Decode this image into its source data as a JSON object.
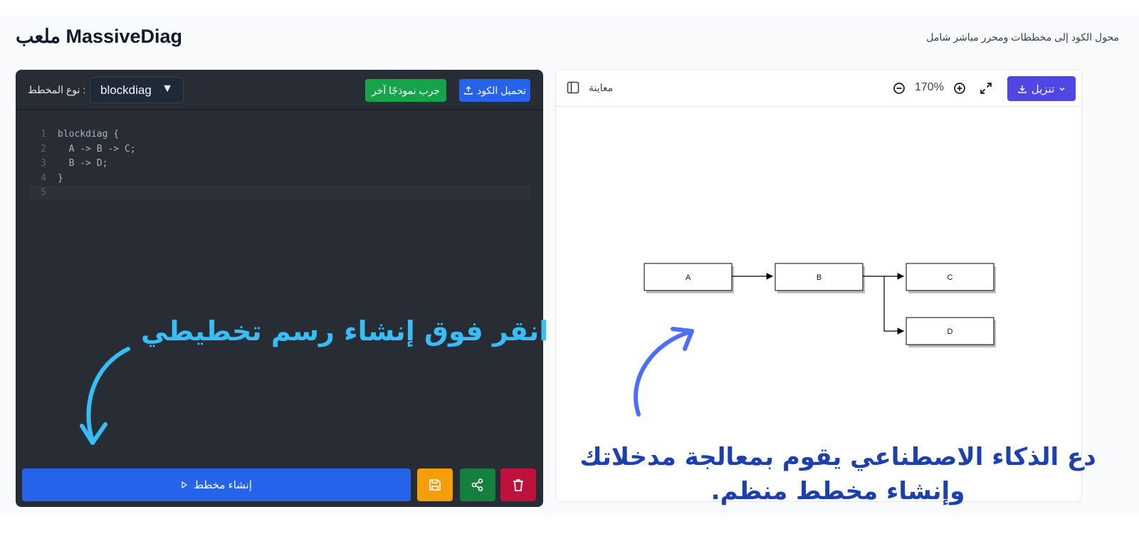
{
  "header": {
    "brand": "MassiveDiag ملعب",
    "tagline": "محول الكود إلى مخططات ومحرر مباشر شامل"
  },
  "editor": {
    "type_label": ": نوع المخطط",
    "type_value": "blockdiag",
    "try_example_label": "جرب نموذجًا آخر",
    "upload_label": "تحميل الكود",
    "code_lines": [
      {
        "n": "1",
        "text": "blockdiag {"
      },
      {
        "n": "2",
        "text": "  A -> B -> C;"
      },
      {
        "n": "3",
        "text": "  B -> D;"
      },
      {
        "n": "4",
        "text": "}"
      },
      {
        "n": "5",
        "text": ""
      }
    ],
    "generate_label": "إنشاء مخطط",
    "colors": {
      "bg": "#282c34",
      "generate": "#2563eb",
      "save": "#f59e0b",
      "share": "#15803d",
      "delete": "#be123c"
    }
  },
  "preview": {
    "title": "معاينة",
    "zoom": "170%",
    "download_label": "تنزيل",
    "nodes": [
      {
        "id": "A",
        "label": "A"
      },
      {
        "id": "B",
        "label": "B"
      },
      {
        "id": "C",
        "label": "C"
      },
      {
        "id": "D",
        "label": "D"
      }
    ],
    "edges": [
      [
        "A",
        "B"
      ],
      [
        "B",
        "C"
      ],
      [
        "B",
        "D"
      ]
    ]
  },
  "annotations": {
    "click_hint": "انقر فوق إنشاء رسم تخطيطي",
    "ai_hint": "دع الذكاء الاصطناعي يقوم بمعالجة مدخلاتك وإنشاء مخطط منظم."
  }
}
